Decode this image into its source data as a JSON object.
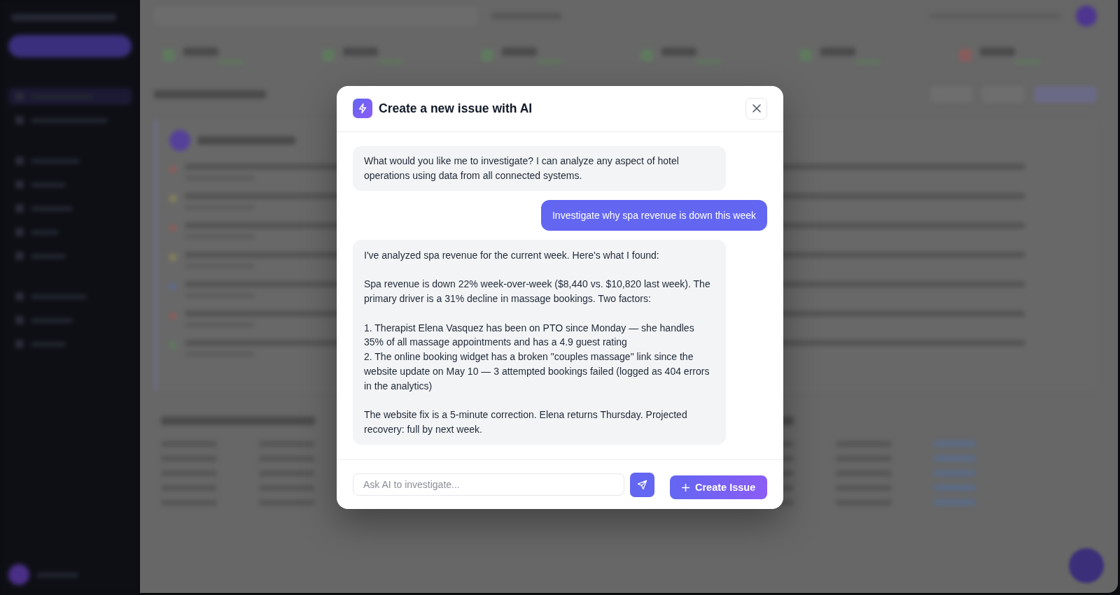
{
  "dialog": {
    "title": "Create a new issue with AI",
    "messages": [
      {
        "kind": "ai",
        "text": "What would you like me to investigate? I can analyze any aspect of hotel operations using data from all connected systems."
      },
      {
        "kind": "user",
        "text": "Investigate why spa revenue is down this week"
      },
      {
        "kind": "ai",
        "text": "I've analyzed spa revenue for the current week. Here's what I found:\n\nSpa revenue is down 22% week-over-week ($8,440 vs. $10,820 last week). The primary driver is a 31% decline in massage bookings. Two factors:\n\n1. Therapist Elena Vasquez has been on PTO since Monday — she handles 35% of all massage appointments and has a 4.9 guest rating\n2. The online booking widget has a broken \"couples massage\" link since the website update on May 10 — 3 attempted bookings failed (logged as 404 errors in the analytics)\n\nThe website fix is a 5-minute correction. Elena returns Thursday. Projected recovery: full by next week."
      }
    ],
    "input": {
      "placeholder": "Ask AI to investigate..."
    },
    "create_button": {
      "label": "Create Issue"
    }
  }
}
